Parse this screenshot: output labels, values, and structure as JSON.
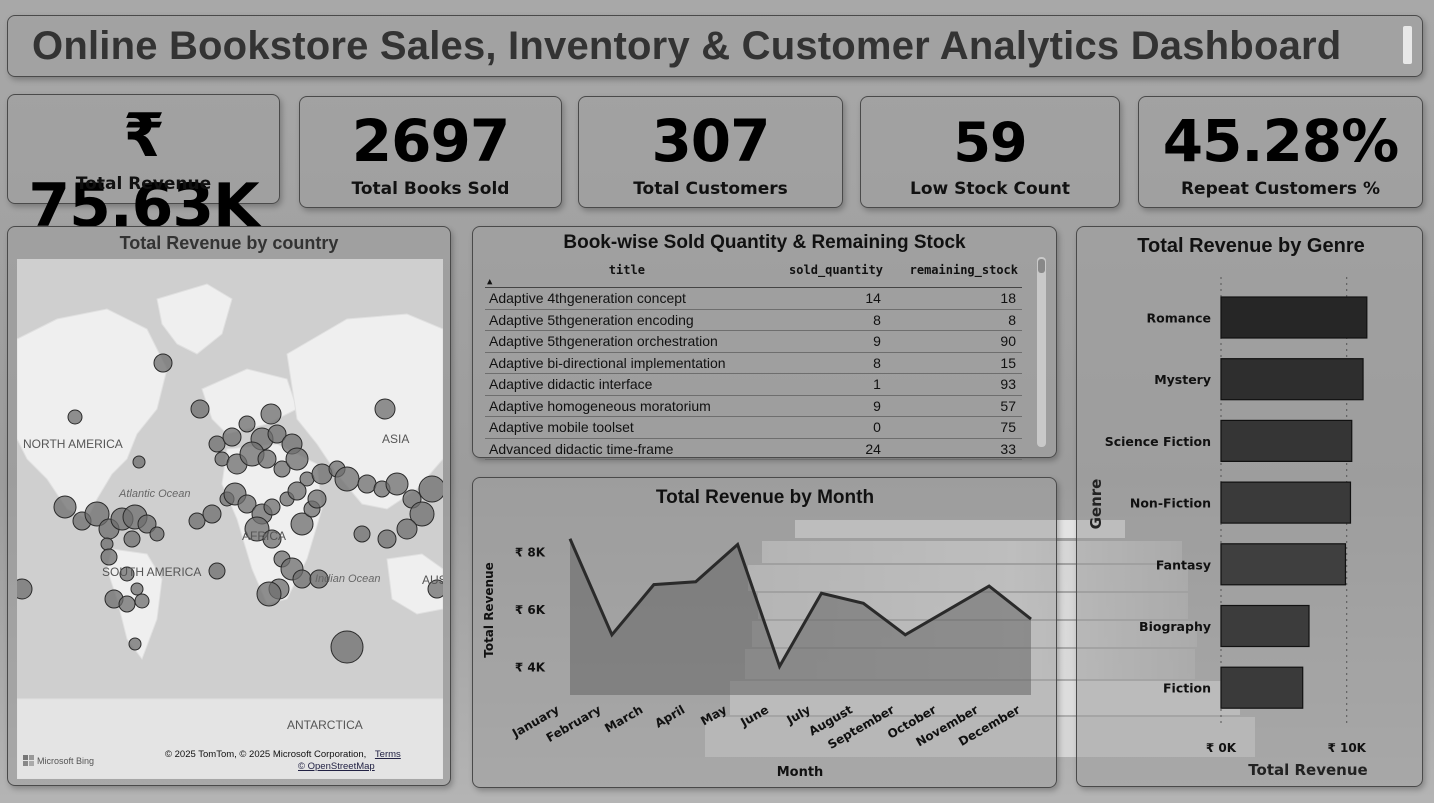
{
  "dashboard": {
    "title": "Online Bookstore Sales, Inventory & Customer Analytics Dashboard"
  },
  "kpis": [
    {
      "value": "₹ 75.63K",
      "label": "Total Revenue"
    },
    {
      "value": "2697",
      "label": "Total Books Sold"
    },
    {
      "value": "307",
      "label": "Total Customers"
    },
    {
      "value": "59",
      "label": "Low Stock Count"
    },
    {
      "value": "45.28%",
      "label": "Repeat Customers %"
    }
  ],
  "map": {
    "title": "Total Revenue by country",
    "labels": {
      "north_america": "NORTH AMERICA",
      "south_america": "SOUTH AMERICA",
      "asia": "ASIA",
      "africa": "AFRICA",
      "aus": "AUS",
      "antarctica": "ANTARCTICA",
      "atlantic": "Atlantic Ocean",
      "indian": "Indian Ocean"
    },
    "attribution": "© 2025 TomTom, © 2025 Microsoft Corporation,",
    "terms": "Terms",
    "osm": "© OpenStreetMap",
    "brand": "Microsoft Bing"
  },
  "table": {
    "title": "Book-wise Sold Quantity & Remaining Stock",
    "columns": [
      "title",
      "sold_quantity",
      "remaining_stock"
    ],
    "rows": [
      [
        "Adaptive 4thgeneration concept",
        "14",
        "18"
      ],
      [
        "Adaptive 5thgeneration encoding",
        "8",
        "8"
      ],
      [
        "Adaptive 5thgeneration orchestration",
        "9",
        "90"
      ],
      [
        "Adaptive bi-directional implementation",
        "8",
        "15"
      ],
      [
        "Adaptive didactic interface",
        "1",
        "93"
      ],
      [
        "Adaptive homogeneous moratorium",
        "9",
        "57"
      ],
      [
        "Adaptive mobile toolset",
        "0",
        "75"
      ],
      [
        "Advanced didactic time-frame",
        "24",
        "33"
      ]
    ]
  },
  "chart_data": [
    {
      "type": "area",
      "title": "Total Revenue by Month",
      "xlabel": "Month",
      "ylabel": "Total Revenue",
      "categories": [
        "January",
        "February",
        "March",
        "April",
        "May",
        "June",
        "July",
        "August",
        "September",
        "October",
        "November",
        "December"
      ],
      "values": [
        8450,
        5100,
        6850,
        6950,
        8250,
        4000,
        6550,
        6200,
        5100,
        5950,
        6800,
        5650
      ],
      "ylim": [
        3000,
        9000
      ],
      "yticks": [
        4000,
        6000,
        8000
      ],
      "ytick_labels": [
        "₹ 4K",
        "₹ 6K",
        "₹ 8K"
      ]
    },
    {
      "type": "bar",
      "orientation": "horizontal",
      "title": "Total Revenue by Genre",
      "xlabel": "Total Revenue",
      "ylabel": "Genre",
      "categories": [
        "Romance",
        "Mystery",
        "Science Fiction",
        "Non-Fiction",
        "Fantasy",
        "Biography",
        "Fiction"
      ],
      "values": [
        11600,
        11300,
        10400,
        10300,
        9900,
        7000,
        6500
      ],
      "xlim": [
        0,
        14000
      ],
      "xticks": [
        0,
        10000
      ],
      "xtick_labels": [
        "₹ 0K",
        "₹ 10K"
      ]
    }
  ]
}
